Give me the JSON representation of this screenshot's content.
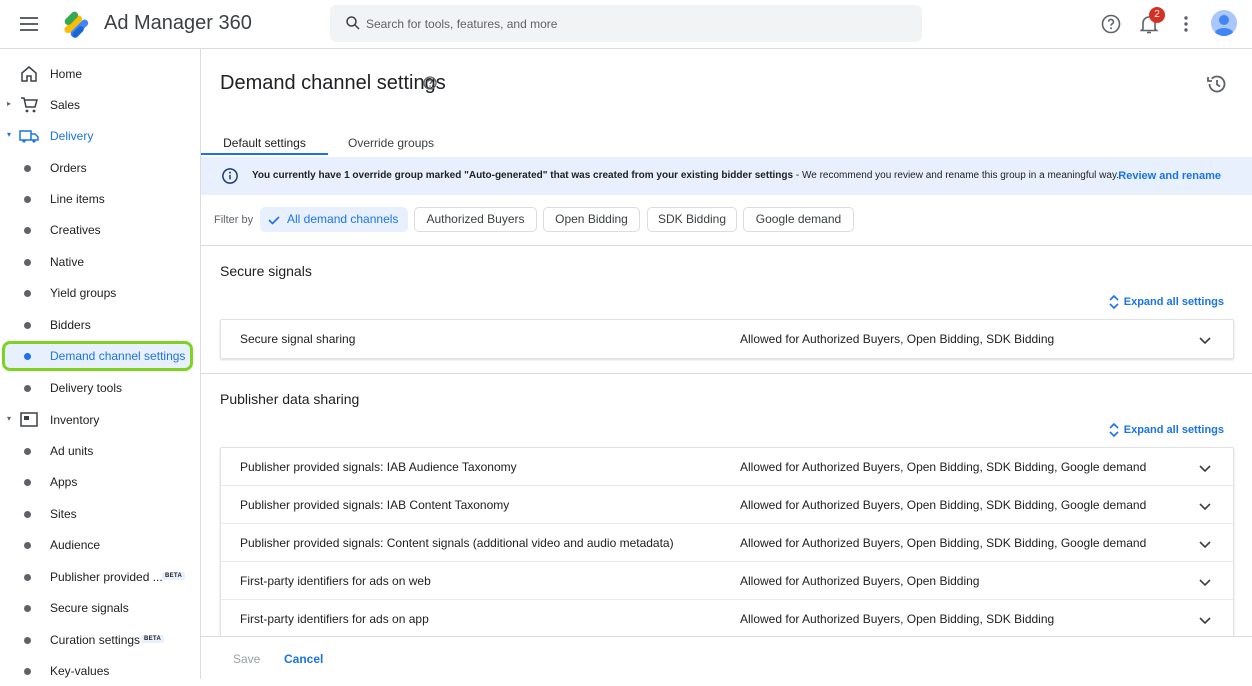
{
  "app": {
    "title": "Ad Manager 360"
  },
  "search": {
    "placeholder": "Search for tools, features, and more"
  },
  "topbar": {
    "notification_count": "2"
  },
  "sidebar": {
    "items": [
      {
        "label": "Home"
      },
      {
        "label": "Sales"
      },
      {
        "label": "Delivery"
      },
      {
        "label": "Orders"
      },
      {
        "label": "Line items"
      },
      {
        "label": "Creatives"
      },
      {
        "label": "Native"
      },
      {
        "label": "Yield groups"
      },
      {
        "label": "Bidders"
      },
      {
        "label": "Demand channel settings"
      },
      {
        "label": "Delivery tools"
      },
      {
        "label": "Inventory"
      },
      {
        "label": "Ad units"
      },
      {
        "label": "Apps"
      },
      {
        "label": "Sites"
      },
      {
        "label": "Audience"
      },
      {
        "label": "Publisher provided ...",
        "badge": "BETA"
      },
      {
        "label": "Secure signals"
      },
      {
        "label": "Curation settings",
        "badge": "BETA"
      },
      {
        "label": "Key-values"
      }
    ]
  },
  "page": {
    "title": "Demand channel settings"
  },
  "tabs": [
    {
      "label": "Default settings"
    },
    {
      "label": "Override groups"
    }
  ],
  "banner": {
    "message_bold": "You currently have 1 override group marked \"Auto-generated\" that was created from your existing bidder settings",
    "message_rest": " - We recommend you review and rename this group in a meaningful way.",
    "action": "Review and rename"
  },
  "filter": {
    "label": "Filter by",
    "chips": [
      {
        "label": "All demand channels"
      },
      {
        "label": "Authorized Buyers"
      },
      {
        "label": "Open Bidding"
      },
      {
        "label": "SDK Bidding"
      },
      {
        "label": "Google demand"
      }
    ]
  },
  "sections": [
    {
      "title": "Secure signals",
      "expand_label": "Expand all settings",
      "rows": [
        {
          "name": "Secure signal sharing",
          "value": "Allowed for Authorized Buyers, Open Bidding, SDK Bidding"
        }
      ]
    },
    {
      "title": "Publisher data sharing",
      "expand_label": "Expand all settings",
      "rows": [
        {
          "name": "Publisher provided signals: IAB Audience Taxonomy",
          "value": "Allowed for Authorized Buyers, Open Bidding, SDK Bidding, Google demand"
        },
        {
          "name": "Publisher provided signals: IAB Content Taxonomy",
          "value": "Allowed for Authorized Buyers, Open Bidding, SDK Bidding, Google demand"
        },
        {
          "name": "Publisher provided signals: Content signals (additional video and audio metadata)",
          "value": "Allowed for Authorized Buyers, Open Bidding, SDK Bidding, Google demand"
        },
        {
          "name": "First-party identifiers for ads on web",
          "value": "Allowed for Authorized Buyers, Open Bidding"
        },
        {
          "name": "First-party identifiers for ads on app",
          "value": "Allowed for Authorized Buyers, Open Bidding, SDK Bidding"
        }
      ]
    }
  ],
  "footer": {
    "save": "Save",
    "cancel": "Cancel"
  },
  "colors": {
    "accent": "#1a73e8",
    "highlight": "#7ed321",
    "banner_bg": "#e8f0fe"
  }
}
